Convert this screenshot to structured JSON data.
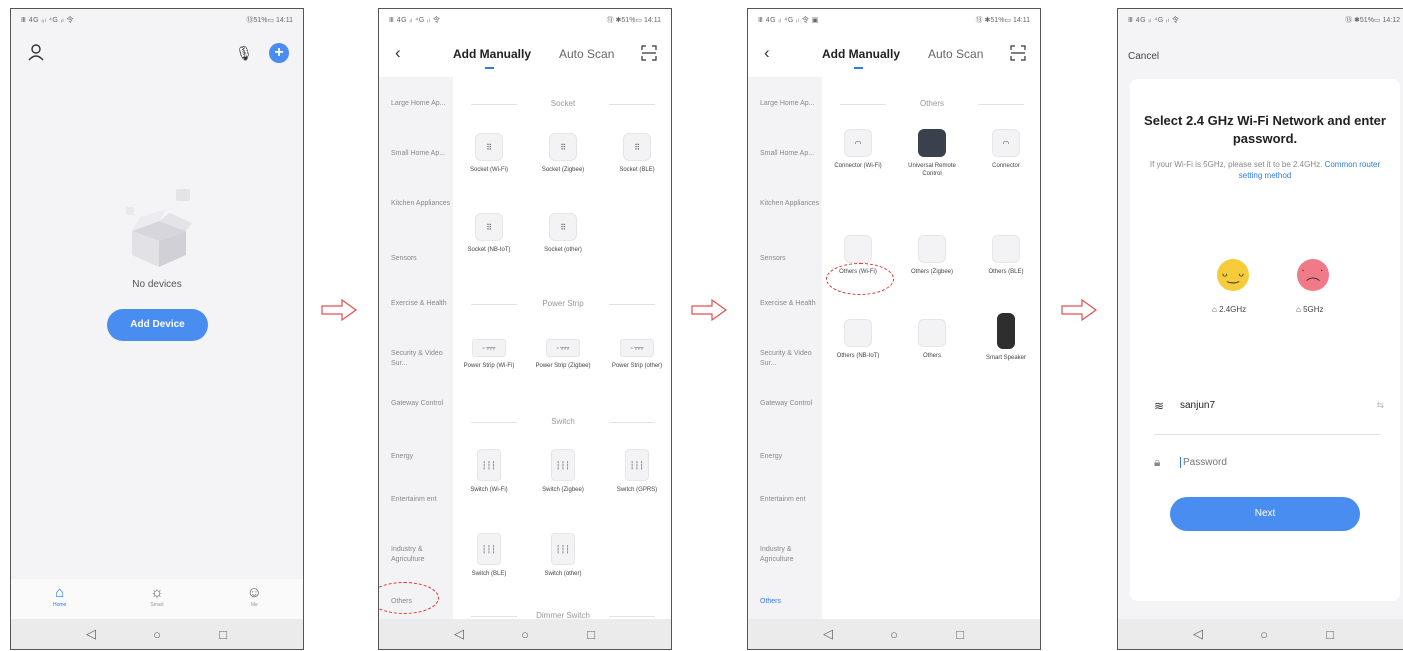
{
  "status": {
    "p1": {
      "signal": "Ⅲ 4G ᵢᵢₗ ⁴G ᵢₗ 令",
      "right": "⑬51%▭ 14:11"
    },
    "p2": {
      "signal": "Ⅲ 4G ᵢₗ ⁴G ᵢₗ 令",
      "right": "⑬ ✱51%▭ 14:11"
    },
    "p3": {
      "signal": "Ⅲ 4G ᵢₗ ⁴G ᵢₗ 令 ▣",
      "right": "⑬ ✱51%▭ 14:11"
    },
    "p4": {
      "signal": "Ⅲ 4G ᵢₗ ⁴G ᵢₗ 令",
      "right": "⑬ ✱51%▭ 14:12"
    }
  },
  "home": {
    "no_devices": "No devices",
    "add_device": "Add Device",
    "tabs": [
      {
        "icon": "⌂",
        "label": "Home"
      },
      {
        "icon": "☼",
        "label": "Smart"
      },
      {
        "icon": "☺",
        "label": "Me"
      }
    ]
  },
  "category": {
    "tab_manual": "Add Manually",
    "tab_auto": "Auto Scan",
    "sidebar": [
      "Large Home Ap...",
      "Small Home Ap...",
      "Kitchen Appliances",
      "Sensors",
      "Exercise & Health",
      "Security & Video Sur...",
      "Gateway Control",
      "Energy",
      "Entertainm ent",
      "Industry & Agriculture",
      "Others"
    ],
    "socket": {
      "title": "Socket",
      "items": [
        "Socket (Wi-Fi)",
        "Socket (Zigbee)",
        "Socket (BLE)",
        "Socket (NB-IoT)",
        "Socket (other)"
      ]
    },
    "power_strip": {
      "title": "Power Strip",
      "items": [
        "Power Strip (Wi-Fi)",
        "Power Strip (Zigbee)",
        "Power Strip (other)"
      ]
    },
    "switch": {
      "title": "Switch",
      "items": [
        "Switch (Wi-Fi)",
        "Switch (Zigbee)",
        "Switch (GPRS)",
        "Switch (BLE)",
        "Switch (other)"
      ]
    },
    "dimmer_title": "Dimmer Switch",
    "others": {
      "title": "Others",
      "items": [
        "Connector (Wi-Fi)",
        "Universal Remote Control",
        "Connector",
        "Others (Wi-Fi)",
        "Others (Zigbee)",
        "Others (BLE)",
        "Others (NB-IoT)",
        "Others",
        "Smart Speaker"
      ]
    }
  },
  "wifi": {
    "cancel": "Cancel",
    "title": "Select 2.4 GHz Wi-Fi Network and enter password.",
    "desc": "If your Wi-Fi is 5GHz, please set it to be 2.4GHz.",
    "link": "Common router setting method",
    "band_24": "2.4GHz",
    "band_5": "5GHz",
    "ssid": "sanjun7",
    "password_placeholder": "Password",
    "next": "Next"
  }
}
